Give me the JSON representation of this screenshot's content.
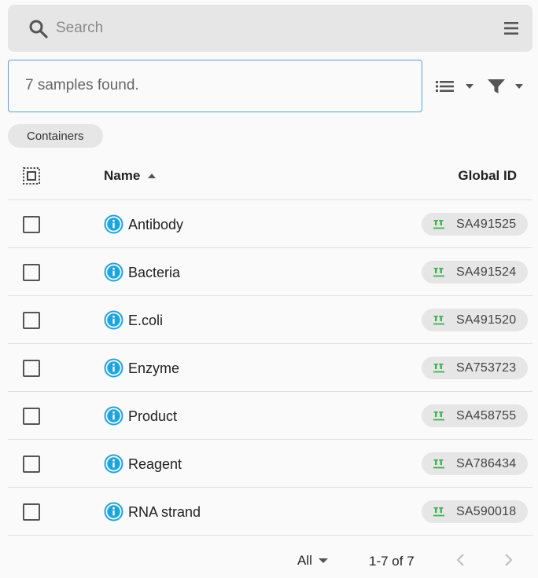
{
  "search": {
    "placeholder": "Search",
    "value": ""
  },
  "results": {
    "message": "7 samples found."
  },
  "chips": {
    "containers": "Containers"
  },
  "table": {
    "columns": {
      "name": "Name",
      "global_id": "Global ID"
    },
    "rows": [
      {
        "name": "Antibody",
        "global_id": "SA491525"
      },
      {
        "name": "Bacteria",
        "global_id": "SA491524"
      },
      {
        "name": "E.coli",
        "global_id": "SA491520"
      },
      {
        "name": "Enzyme",
        "global_id": "SA753723"
      },
      {
        "name": "Product",
        "global_id": "SA458755"
      },
      {
        "name": "Reagent",
        "global_id": "SA786434"
      },
      {
        "name": "RNA strand",
        "global_id": "SA590018"
      }
    ]
  },
  "pagination": {
    "per_page": "All",
    "range": "1-7 of 7"
  },
  "colors": {
    "info": "#1ba4e0",
    "sample_icon": "#3cb44b",
    "border_focus": "#5a9fd8"
  },
  "icons": {
    "search": "search-icon",
    "menu": "menu-icon",
    "list": "list-view-icon",
    "filter": "filter-icon",
    "select_all": "select-all-icon",
    "info": "info-icon",
    "sample": "sample-icon",
    "prev": "chevron-left-icon",
    "next": "chevron-right-icon"
  }
}
